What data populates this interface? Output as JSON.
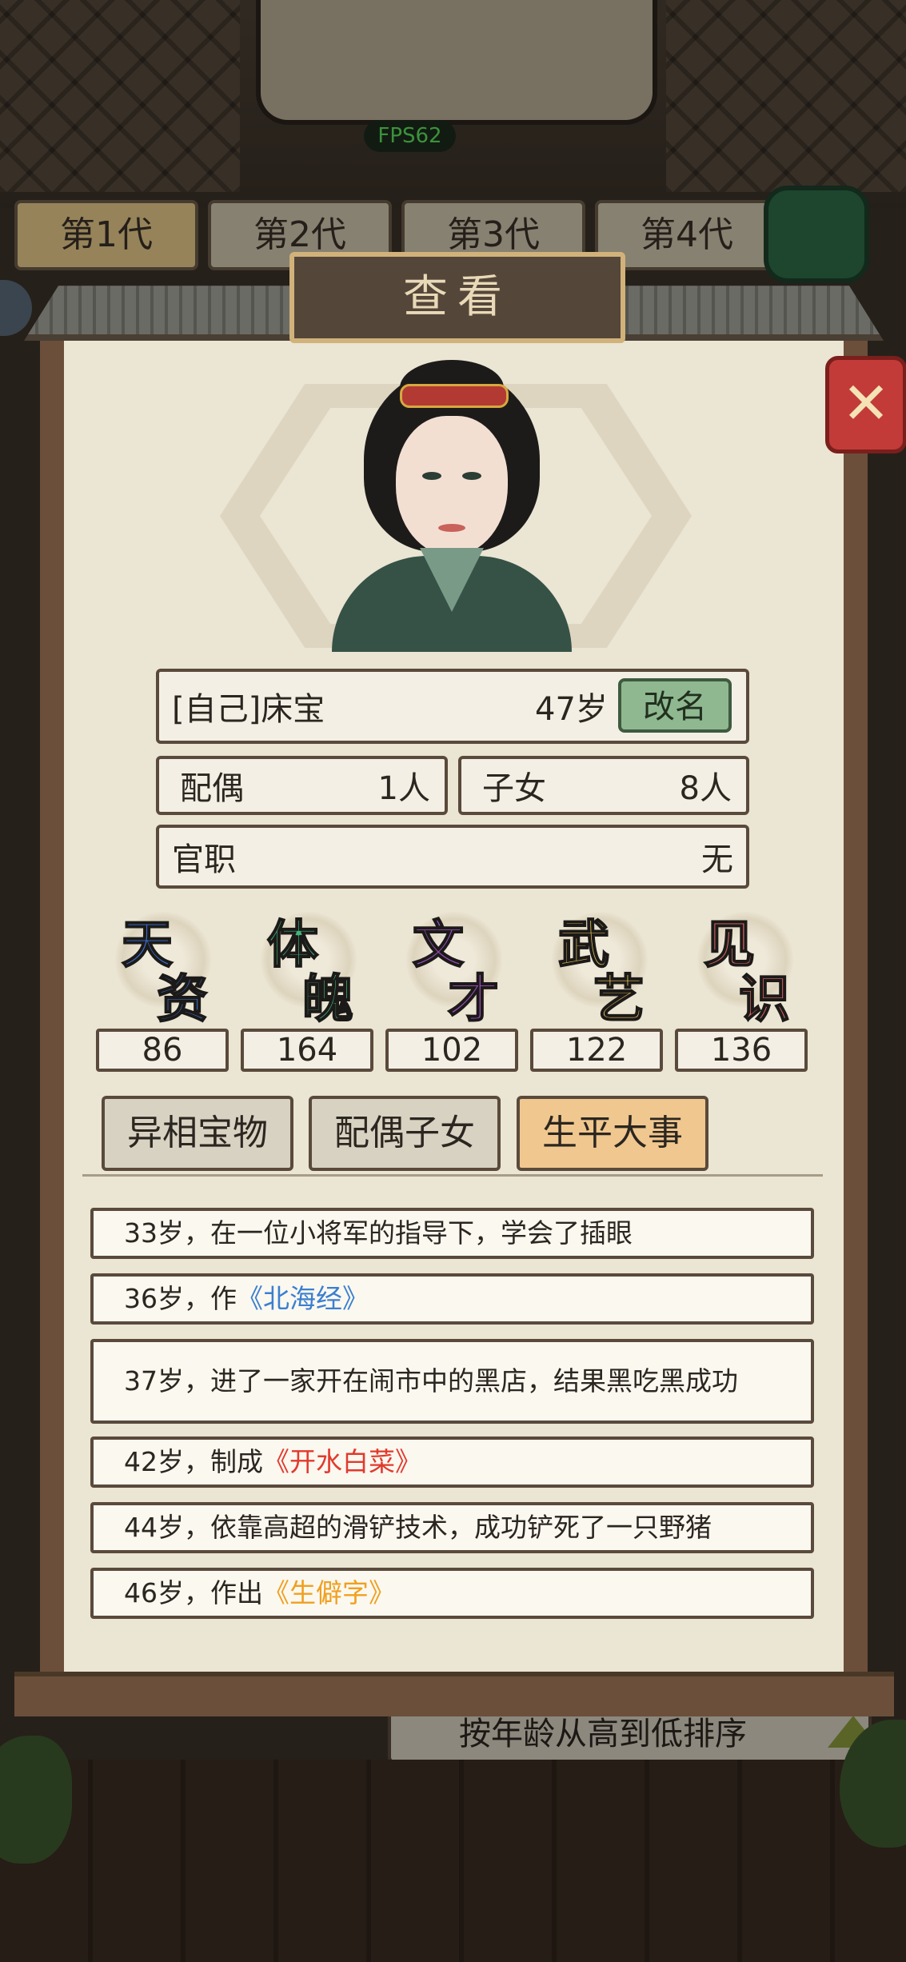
{
  "app": {
    "fps": "FPS62"
  },
  "generations": [
    "第1代",
    "第2代",
    "第3代",
    "第4代"
  ],
  "panel": {
    "title": "查看"
  },
  "profile": {
    "name": "[自己]床宝",
    "age": "47岁",
    "rename_label": "改名",
    "spouse_label": "配偶",
    "spouse_value": "1人",
    "children_label": "子女",
    "children_value": "8人",
    "office_label": "官职",
    "office_value": "无"
  },
  "stats": [
    {
      "c1": "天",
      "c2": "资",
      "value": "86",
      "color": "#3a72d8"
    },
    {
      "c1": "体",
      "c2": "魄",
      "value": "164",
      "color": "#3fb57a"
    },
    {
      "c1": "文",
      "c2": "才",
      "value": "102",
      "color": "#a24fc9"
    },
    {
      "c1": "武",
      "c2": "艺",
      "value": "122",
      "color": "#e8c25a"
    },
    {
      "c1": "见",
      "c2": "识",
      "value": "136",
      "color": "#e06a68"
    }
  ],
  "tabs": [
    "异相宝物",
    "配偶子女",
    "生平大事"
  ],
  "active_tab": "生平大事",
  "events": [
    {
      "text": "33岁，在一位小将军的指导下，学会了插眼",
      "book": ""
    },
    {
      "text": "36岁，作",
      "book": "《北海经》",
      "book_color": "blue"
    },
    {
      "text": "37岁，进了一家开在闹市中的黑店，结果黑吃黑成功",
      "book": ""
    },
    {
      "text": "42岁，制成",
      "book": "《开水白菜》",
      "book_color": "red"
    },
    {
      "text": "44岁，依靠高超的滑铲技术，成功铲死了一只野猪",
      "book": ""
    },
    {
      "text": "46岁，作出",
      "book": "《生僻字》",
      "book_color": "orange"
    }
  ],
  "sort": {
    "label": "按年龄从高到低排序"
  }
}
